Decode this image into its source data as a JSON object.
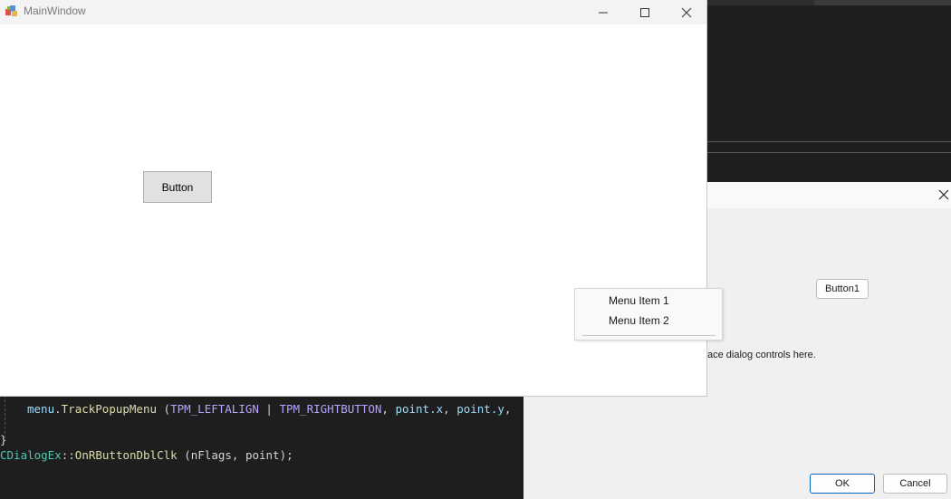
{
  "main_window": {
    "title": "MainWindow",
    "button_label": "Button"
  },
  "context_menu": {
    "items": [
      {
        "label": "Menu Item 1"
      },
      {
        "label": "Menu Item 2"
      }
    ]
  },
  "dialog": {
    "button1_label": "Button1",
    "static_text": "ace dialog controls here.",
    "ok_label": "OK",
    "cancel_label": "Cancel"
  },
  "code": {
    "line1": {
      "obj": "menu",
      "fn": "TrackPopupMenu",
      "arg1": "TPM_LEFTALIGN",
      "arg2": "TPM_RIGHTBUTTON",
      "arg3": "point.x",
      "arg4": "point.y"
    },
    "line2": "}",
    "line3": {
      "cls": "CDialogEx",
      "fn": "OnRButtonDblClk",
      "args": "(nFlags, point);"
    }
  },
  "colors": {
    "ide_bg": "#1e1e1e",
    "dialog_bg": "#f0f0f0",
    "accent": "#0067c0"
  }
}
